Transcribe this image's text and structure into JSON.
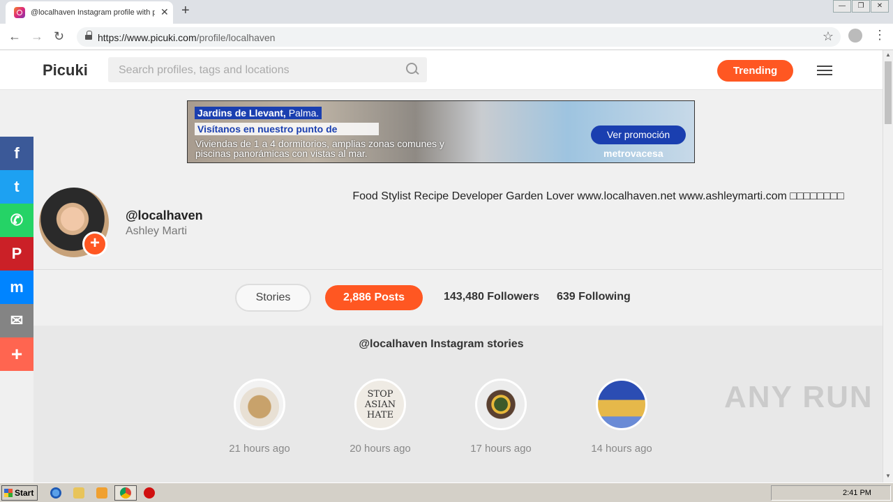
{
  "browser": {
    "tab_title": "@localhaven Instagram profile with p",
    "tab_close": "✕",
    "new_tab": "+",
    "window_buttons": [
      "—",
      "❐",
      "✕"
    ],
    "url_prefix": "https://www.picuki.com",
    "url_path": "/profile/localhaven",
    "star": "☆",
    "menu": "⋮"
  },
  "header": {
    "logo": "Picuki",
    "search_placeholder": "Search profiles, tags and locations",
    "trending_label": "Trending"
  },
  "ad": {
    "line1_bold": "Jardins de Llevant,",
    "line1_rest": " Palma.",
    "line2": "Visítanos en nuestro punto de",
    "line3": "Viviendas de 1 a 4 dormitorios, amplias zonas comunes y piscinas panorámicas con vistas al mar.",
    "button": "Ver promoción",
    "brand": "metrovacesa"
  },
  "share": [
    {
      "name": "facebook",
      "glyph": "f",
      "color": "#3b5998"
    },
    {
      "name": "twitter",
      "glyph": "t",
      "color": "#1da1f2"
    },
    {
      "name": "whatsapp",
      "glyph": "✆",
      "color": "#25d366"
    },
    {
      "name": "pinterest",
      "glyph": "P",
      "color": "#cb2027"
    },
    {
      "name": "messenger",
      "glyph": "m",
      "color": "#0084ff"
    },
    {
      "name": "email",
      "glyph": "✉",
      "color": "#848484"
    },
    {
      "name": "more",
      "glyph": "+",
      "color": "#ff6550"
    }
  ],
  "profile": {
    "username": "@localhaven",
    "full_name": "Ashley Marti",
    "bio": "Food Stylist Recipe Developer Garden Lover www.localhaven.net www.ashleymarti.com □□□□□□□□",
    "add_label": "+"
  },
  "stats": {
    "stories": "Stories",
    "posts": "2,886 Posts",
    "followers": "143,480 Followers",
    "following": "639 Following"
  },
  "stories": {
    "title": "@localhaven Instagram stories",
    "items": [
      {
        "time": "21 hours ago"
      },
      {
        "time": "20 hours ago",
        "text": "STOP ASIAN HATE"
      },
      {
        "time": "17 hours ago"
      },
      {
        "time": "14 hours ago"
      }
    ]
  },
  "watermark": "ANY RUN",
  "taskbar": {
    "start": "Start",
    "clock": "2:41 PM"
  }
}
